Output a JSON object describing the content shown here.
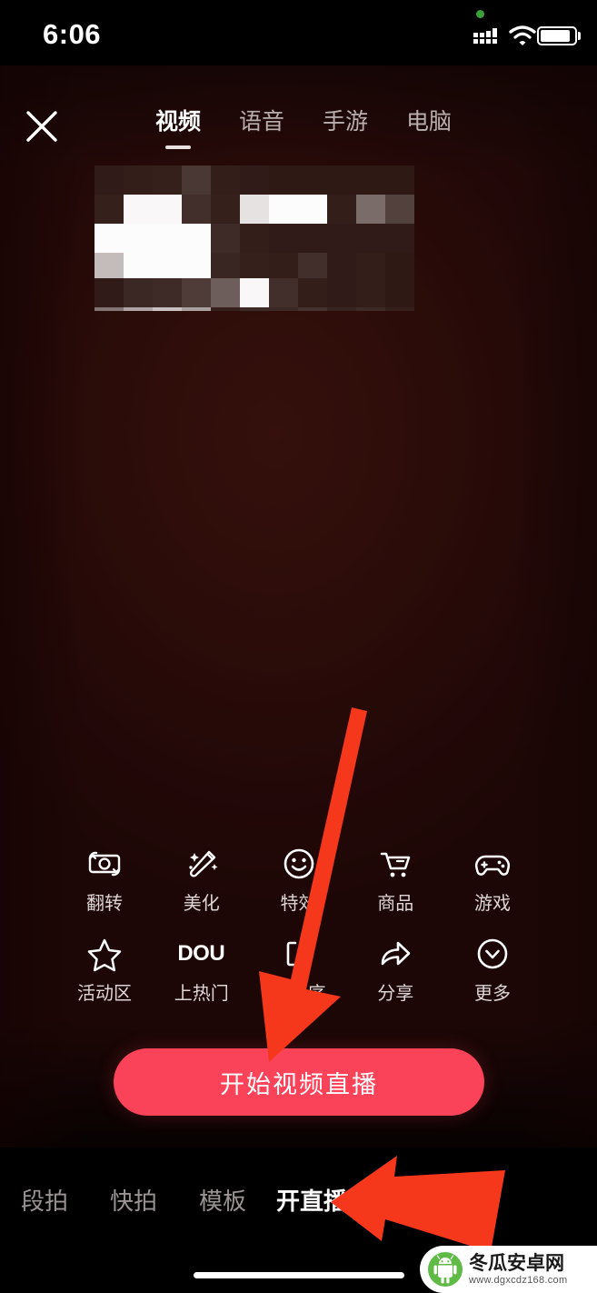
{
  "status_bar": {
    "time": "6:06",
    "signal_icon": "cellular-signal-icon",
    "wifi_icon": "wifi-icon",
    "battery_icon": "battery-icon",
    "recording_dot": "green-status-dot"
  },
  "top_bar": {
    "close_icon": "close-x-icon",
    "tabs": [
      {
        "label": "视频",
        "active": true
      },
      {
        "label": "语音",
        "active": false
      },
      {
        "label": "手游",
        "active": false
      },
      {
        "label": "电脑",
        "active": false
      }
    ]
  },
  "preview": {
    "censored_region": "pixelated-mosaic-block"
  },
  "tools": {
    "row1": [
      {
        "label": "翻转",
        "icon": "camera-flip-icon"
      },
      {
        "label": "美化",
        "icon": "magic-wand-beautify-icon"
      },
      {
        "label": "特效",
        "icon": "smiley-effects-icon"
      },
      {
        "label": "商品",
        "icon": "shopping-cart-icon"
      },
      {
        "label": "游戏",
        "icon": "gamepad-icon"
      }
    ],
    "row2": [
      {
        "label": "活动区",
        "icon": "star-icon"
      },
      {
        "label": "上热门",
        "icon": "dou-plus-logo"
      },
      {
        "label": "小程序",
        "icon": "mini-program-icon"
      },
      {
        "label": "分享",
        "icon": "share-arrow-icon"
      },
      {
        "label": "更多",
        "icon": "chevron-down-circle-icon"
      }
    ]
  },
  "cta": {
    "label": "开始视频直播",
    "color": "#fa4259"
  },
  "bottom_nav": {
    "tabs": [
      {
        "label": "段拍",
        "active": false
      },
      {
        "label": "快拍",
        "active": false
      },
      {
        "label": "模板",
        "active": false
      },
      {
        "label": "开直播",
        "active": true
      }
    ]
  },
  "annotations": {
    "arrow_color": "#f5381c",
    "arrow_to_cta": "long-arrow-pointing-to-start-live-button",
    "arrow_to_mode_tab": "arrow-pointing-to-kai-zhi-bo-tab"
  },
  "watermark": {
    "title": "冬瓜安卓网",
    "url": "www.dgxcdz168.com",
    "logo_icon": "android-robot-icon",
    "logo_color": "#5fbb46"
  }
}
